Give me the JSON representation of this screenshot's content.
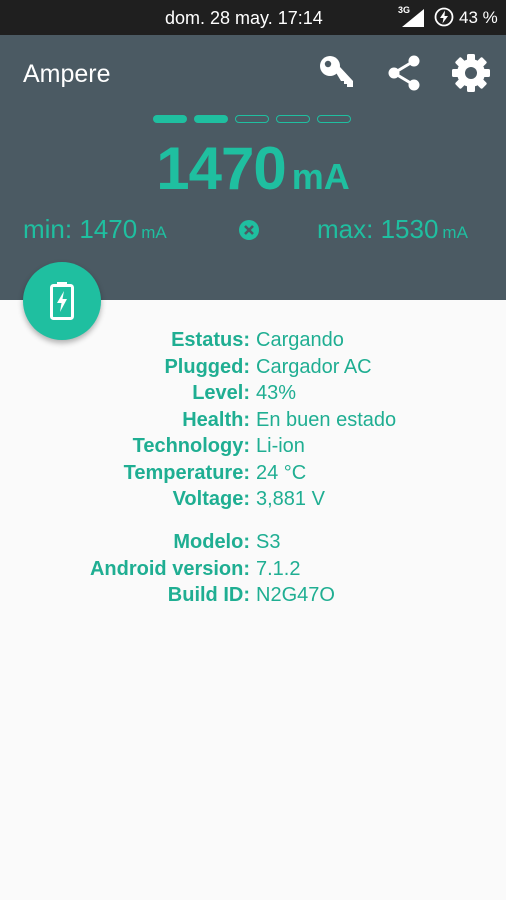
{
  "status_bar": {
    "time": "dom. 28 may. 17:14",
    "network": "3G",
    "battery_percent": "43 %"
  },
  "app": {
    "title": "Ampere",
    "accent_color": "#1fbfa0",
    "header_color": "#4b5a63"
  },
  "toolbar": {
    "icons": [
      "key-icon",
      "share-icon",
      "gear-icon"
    ]
  },
  "pager": {
    "total": 5,
    "active": 2
  },
  "current": {
    "value": "1470",
    "unit": "mA"
  },
  "min": {
    "label": "min: 1470",
    "unit": "mA"
  },
  "max": {
    "label": "max: 1530",
    "unit": "mA"
  },
  "battery_info": [
    {
      "key": "Estatus:",
      "value": "Cargando"
    },
    {
      "key": "Plugged:",
      "value": "Cargador AC"
    },
    {
      "key": "Level:",
      "value": "43%"
    },
    {
      "key": "Health:",
      "value": "En buen estado"
    },
    {
      "key": "Technology:",
      "value": "Li-ion"
    },
    {
      "key": "Temperature:",
      "value": "24 °C"
    },
    {
      "key": "Voltage:",
      "value": "3,881 V"
    }
  ],
  "device_info": [
    {
      "key": "Modelo:",
      "value": "S3"
    },
    {
      "key": "Android version:",
      "value": "7.1.2"
    },
    {
      "key": "Build ID:",
      "value": "N2G47O"
    }
  ]
}
